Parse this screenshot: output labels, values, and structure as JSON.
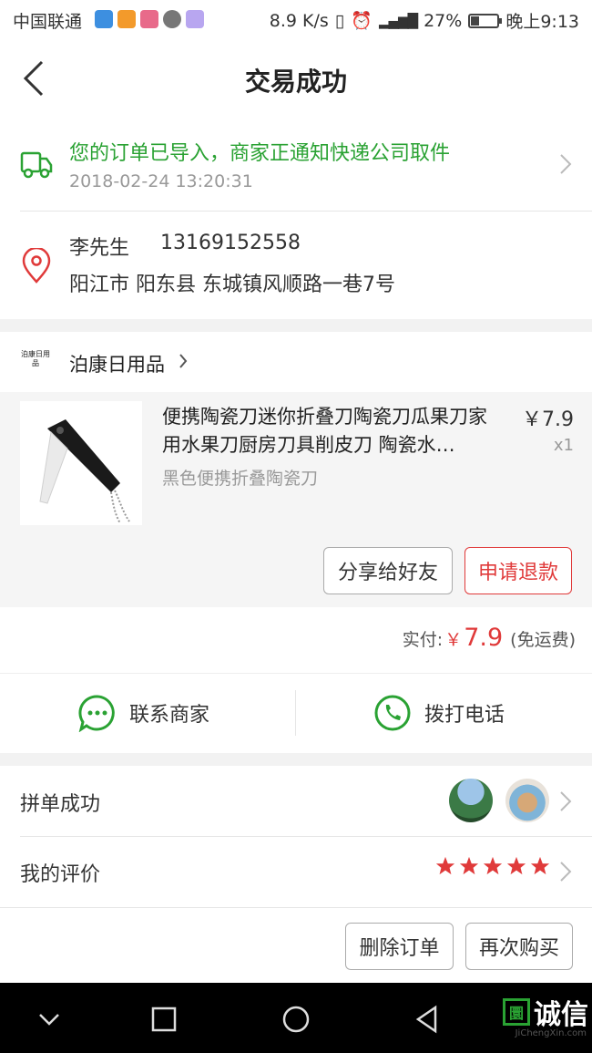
{
  "status_bar": {
    "carrier": "中国联通",
    "speed": "8.9 K/s",
    "battery": "27%",
    "time": "晚上9:13"
  },
  "nav": {
    "title": "交易成功"
  },
  "shipping_notice": {
    "text": "您的订单已导入，商家正通知快递公司取件",
    "time": "2018-02-24 13:20:31"
  },
  "address": {
    "name": "李先生",
    "phone": "13169152558",
    "line": "阳江市 阳东县 东城镇风顺路一巷7号"
  },
  "store": {
    "logo_text": "泊康日用品",
    "name": "泊康日用品"
  },
  "product": {
    "title": "便携陶瓷刀迷你折叠刀陶瓷刀瓜果刀家用水果刀厨房刀具削皮刀 陶瓷水…",
    "price": "￥7.9",
    "qty": "x1",
    "spec": "黑色便携折叠陶瓷刀"
  },
  "actions": {
    "share": "分享给好友",
    "refund": "申请退款"
  },
  "payment": {
    "label": "实付:",
    "currency": "￥",
    "amount": "7.9",
    "note": "(免运费)"
  },
  "contact": {
    "merchant": "联系商家",
    "call": "拨打电话"
  },
  "group": {
    "label": "拼单成功"
  },
  "review": {
    "label": "我的评价",
    "rating": 5
  },
  "bottom_actions": {
    "delete": "删除订单",
    "rebuy": "再次购买"
  },
  "watermark": {
    "mark": "圜",
    "text": "诚信",
    "url": "JiChengXin.com"
  },
  "colors": {
    "green": "#2aa233",
    "red": "#e03a3a"
  }
}
